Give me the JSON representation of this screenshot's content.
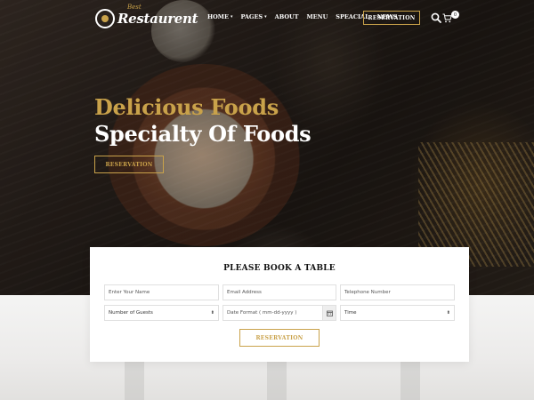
{
  "brand": {
    "name": "Restaurent",
    "script_text": "Best",
    "accent_color": "#c9a24a"
  },
  "nav": {
    "items": [
      {
        "label": "HOME",
        "has_dropdown": true
      },
      {
        "label": "PAGES",
        "has_dropdown": true
      },
      {
        "label": "ABOUT",
        "has_dropdown": false
      },
      {
        "label": "MENU",
        "has_dropdown": false
      },
      {
        "label": "SPEACIAL",
        "has_dropdown": false
      },
      {
        "label": "NEWS",
        "has_dropdown": false
      }
    ],
    "reservation_label": "RESERVATION",
    "cart_count": "0",
    "icons": [
      "search-icon",
      "cart-icon"
    ]
  },
  "hero": {
    "line1": "Delicious Foods",
    "line2": "Specialty Of Foods",
    "button_label": "RESERVATION"
  },
  "booking": {
    "title": "PLEASE BOOK A TABLE",
    "name_placeholder": "Enter Your Name",
    "email_placeholder": "Email Address",
    "phone_placeholder": "Telephone Number",
    "guests_value": "Number of Guests",
    "date_placeholder": "Date Format ( mm-dd-yyyy )",
    "time_value": "Time",
    "button_label": "RESERVATION"
  }
}
